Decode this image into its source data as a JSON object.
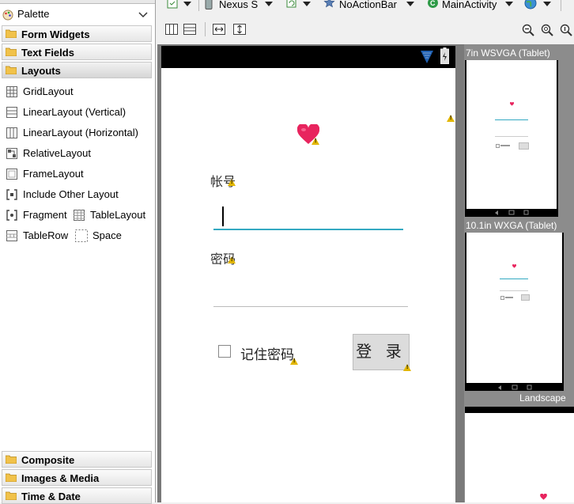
{
  "palette": {
    "title": "Palette",
    "categories_top": [
      "Form Widgets",
      "Text Fields",
      "Layouts"
    ],
    "items": [
      {
        "label": "GridLayout",
        "icon": "grid-layout-icon"
      },
      {
        "label": "LinearLayout (Vertical)",
        "icon": "linear-vertical-icon"
      },
      {
        "label": "LinearLayout (Horizontal)",
        "icon": "linear-horizontal-icon"
      },
      {
        "label": "RelativeLayout",
        "icon": "relative-layout-icon"
      },
      {
        "label": "FrameLayout",
        "icon": "frame-layout-icon"
      },
      {
        "label": "Include Other Layout",
        "icon": "include-layout-icon"
      },
      {
        "label": "Fragment",
        "icon": "fragment-icon"
      },
      {
        "label": "TableLayout",
        "icon": "table-layout-icon"
      },
      {
        "label": "TableRow",
        "icon": "table-row-icon"
      },
      {
        "label": "Space",
        "icon": "space-icon"
      }
    ],
    "categories_bottom": [
      "Composite",
      "Images & Media",
      "Time & Date"
    ]
  },
  "toolbar": {
    "device": "Nexus S",
    "theme": "NoActionBar",
    "activity": "MainActivity"
  },
  "layout_preview": {
    "account_label": "帐号",
    "password_label": "密码",
    "remember_label": "记住密码",
    "login_button": "登 录"
  },
  "previews": {
    "tablet_7": "7in WSVGA (Tablet)",
    "tablet_10": "10.1in WXGA (Tablet)",
    "landscape": "Landscape"
  },
  "colors": {
    "accent": "#33a9c2",
    "heart": "#e8245e",
    "warning": "#e2b600"
  }
}
